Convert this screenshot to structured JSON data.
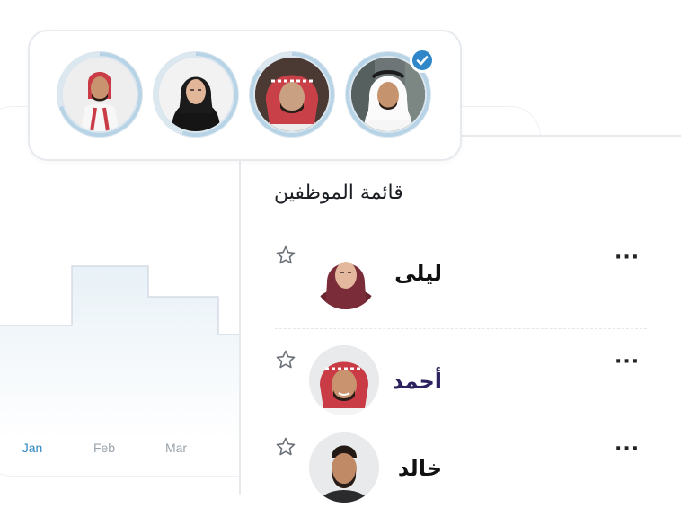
{
  "chart": {
    "months": [
      "Jan",
      "Feb",
      "Mar"
    ],
    "active_month": "Jan",
    "accent_color": "#2f86c2"
  },
  "avatar_strip": {
    "avatars": [
      {
        "icon": "man-red-shemagh-photo",
        "progress": 0.7
      },
      {
        "icon": "woman-black-hijab-photo",
        "progress": 0.55
      },
      {
        "icon": "man-red-shemagh-portrait-photo",
        "progress": 0.85
      },
      {
        "icon": "man-white-ghutra-photo",
        "progress": 1.0,
        "selected": true
      }
    ],
    "selected_badge_icon": "check-icon",
    "badge_color": "#2f86c9"
  },
  "employee_list": {
    "title": "قائمة الموظفين",
    "rows": [
      {
        "name": "ليلى",
        "avatar_icon": "woman-maroon-hijab-photo",
        "star_icon": "star-outline-icon",
        "menu_label": "···"
      },
      {
        "name": "أحمد",
        "avatar_icon": "man-red-shemagh-photo",
        "star_icon": "star-outline-icon",
        "menu_label": "···"
      },
      {
        "name": "خالد",
        "avatar_icon": "man-beard-photo",
        "star_icon": "star-outline-icon",
        "menu_label": "···"
      }
    ]
  }
}
